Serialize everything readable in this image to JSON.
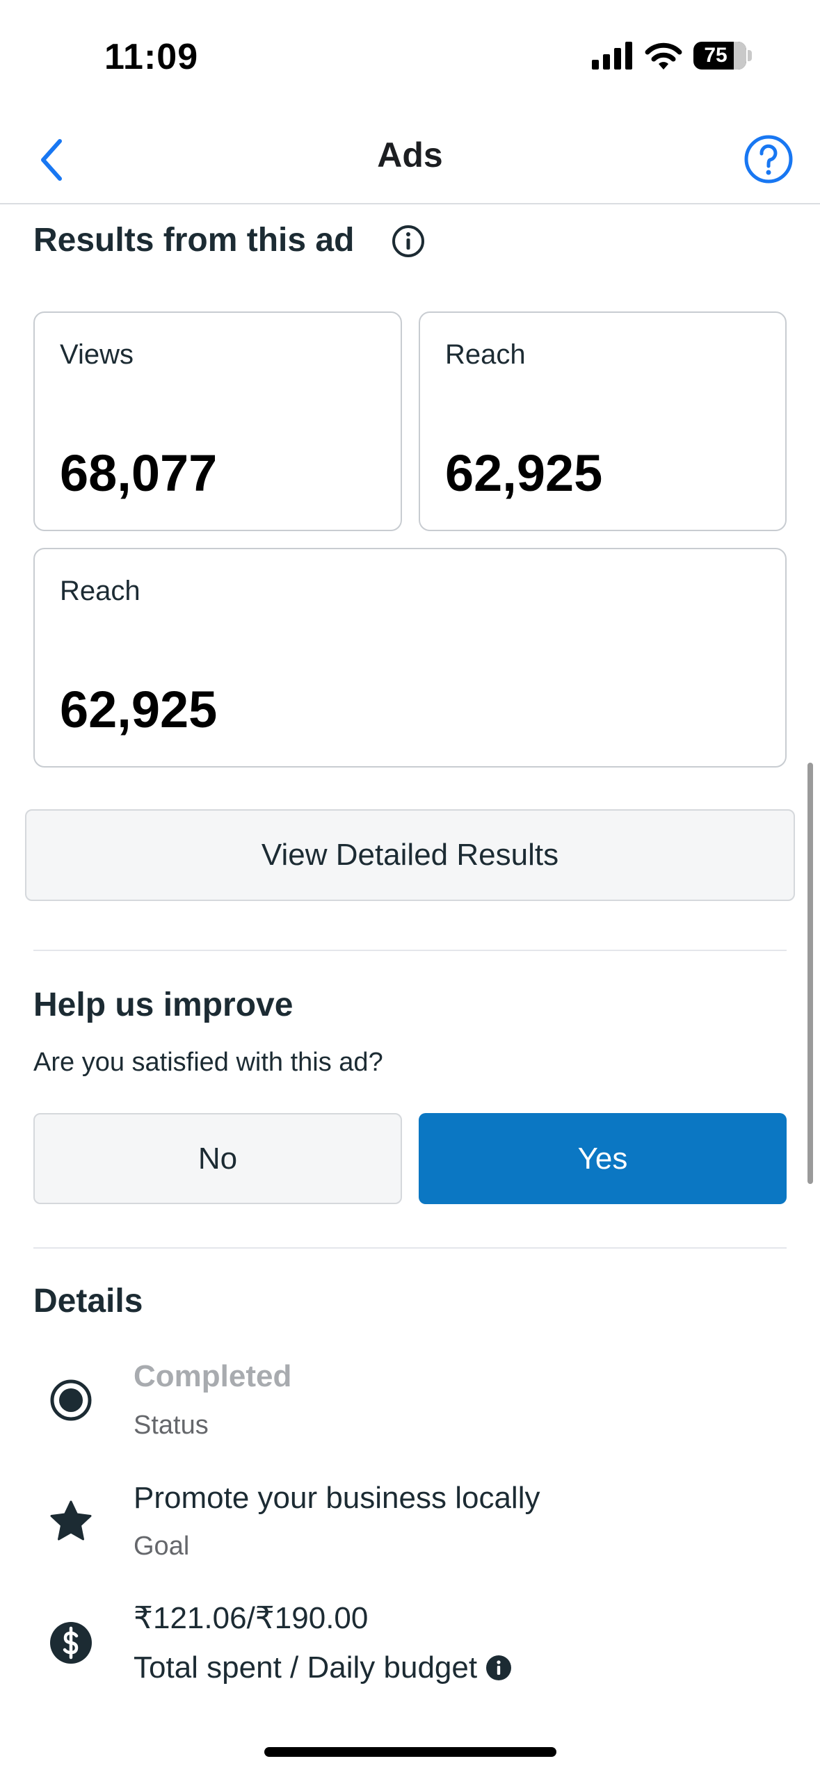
{
  "status_bar": {
    "time": "11:09",
    "battery": "75"
  },
  "nav": {
    "title": "Ads"
  },
  "results": {
    "heading": "Results from this ad",
    "cards": [
      {
        "label": "Views",
        "value": "68,077"
      },
      {
        "label": "Reach",
        "value": "62,925"
      },
      {
        "label": "Reach",
        "value": "62,925"
      }
    ],
    "detailed_button": "View Detailed Results"
  },
  "feedback": {
    "heading": "Help us improve",
    "question": "Are you satisfied with this ad?",
    "no_label": "No",
    "yes_label": "Yes"
  },
  "details": {
    "heading": "Details",
    "items": [
      {
        "icon": "radio-selected-icon",
        "title": "Completed",
        "subtitle": "Status"
      },
      {
        "icon": "star-icon",
        "title": "Promote your business locally",
        "subtitle": "Goal"
      },
      {
        "icon": "dollar-icon",
        "title": "₹121.06/₹190.00",
        "subtitle": "Total spent / Daily budget"
      }
    ]
  },
  "colors": {
    "primary": "#0b77c3",
    "nav_accent": "#1877f2",
    "icon_dark": "#1c2b33"
  }
}
